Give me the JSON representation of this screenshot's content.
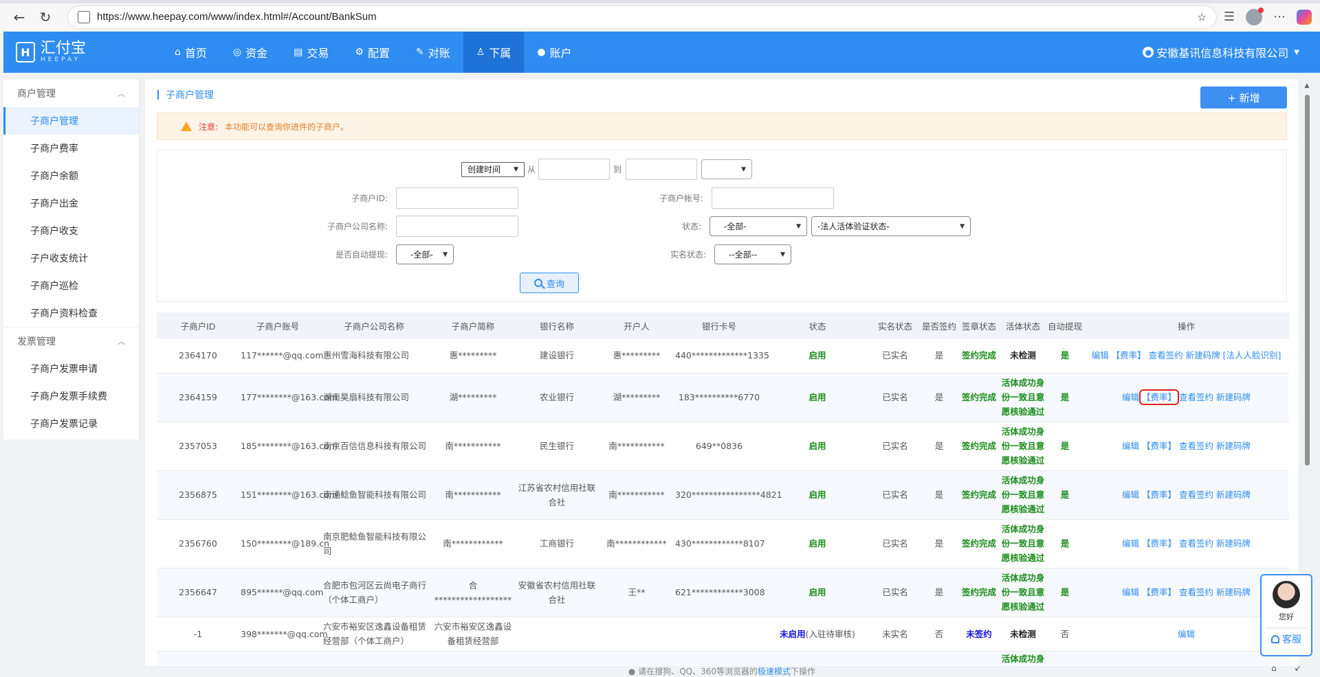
{
  "browser": {
    "url": "https://www.heepay.com/www/index.html#/Account/BankSum"
  },
  "header": {
    "logo_text": "汇付宝",
    "logo_sub": "HEEPAY",
    "nav": [
      {
        "label": "首页",
        "icon": "home-icon"
      },
      {
        "label": "资金",
        "icon": "database-icon"
      },
      {
        "label": "交易",
        "icon": "document-icon"
      },
      {
        "label": "配置",
        "icon": "gear-icon"
      },
      {
        "label": "对账",
        "icon": "edit-icon"
      },
      {
        "label": "下属",
        "icon": "person-icon"
      },
      {
        "label": "账户",
        "icon": "user-icon"
      }
    ],
    "active_nav": "下属",
    "user": "安徽基讯信息科技有限公司"
  },
  "sidebar": {
    "group1": "商户管理",
    "items1": [
      "子商户管理",
      "子商户费率",
      "子商户余额",
      "子商户出金",
      "子商户收支",
      "子户收支统计",
      "子商户巡检",
      "子商户资料检查"
    ],
    "group2": "发票管理",
    "items2": [
      "子商户发票申请",
      "子商户发票手续费",
      "子商户发票记录"
    ]
  },
  "page": {
    "title": "子商户管理",
    "add_label": "+ 新增",
    "notice_label": "注意:",
    "notice_text": "本功能可以查询你进件的子商户。"
  },
  "search": {
    "time_select": "创建时间",
    "from": "从",
    "to": "到",
    "sub_id_label": "子商户ID:",
    "sub_account_label": "子商户帐号:",
    "company_label": "子商户公司名称:",
    "status_label": "状态:",
    "status_value": "-全部-",
    "face_status_value": "-法人活体验证状态-",
    "auto_withdraw_label": "是否自动提现:",
    "auto_withdraw_value": "-全部-",
    "realname_label": "实名状态:",
    "realname_value": "--全部--",
    "query_label": "查询"
  },
  "table": {
    "headers": [
      "子商户ID",
      "子商户账号",
      "子商户公司名称",
      "子商户简称",
      "银行名称",
      "开户人",
      "银行卡号",
      "状态",
      "实名状态",
      "是否签约",
      "签章状态",
      "活体状态",
      "自动提现",
      "操作"
    ],
    "rows": [
      {
        "id": "2364170",
        "account": "117******@qq.com",
        "company": "惠州雪海科技有限公司",
        "short": "惠*********",
        "bank": "建设银行",
        "holder": "惠*********",
        "card": "440*************1335",
        "status": "启用",
        "realname": "已实名",
        "signed": "是",
        "sign_status": "签约完成",
        "face": "未检测",
        "auto": "是",
        "ops": [
          "编辑",
          "【费率】",
          "查看签约",
          "新建码牌",
          "[法人人脸识别]"
        ]
      },
      {
        "id": "2364159",
        "account": "177********@163.com",
        "company": "湖南昊扇科技有限公司",
        "short": "湖*********",
        "bank": "农业银行",
        "holder": "湖*********",
        "card": "183**********6770",
        "status": "启用",
        "realname": "已实名",
        "signed": "是",
        "sign_status": "签约完成",
        "face": "活体成功身份一致且意愿核验通过",
        "auto": "是",
        "ops": [
          "编辑",
          "【费率】",
          "查看签约",
          "新建码牌"
        ]
      },
      {
        "id": "2357053",
        "account": "185********@163.com",
        "company": "南京百信信息科技有限公司",
        "short": "南***********",
        "bank": "民生银行",
        "holder": "南***********",
        "card": "649**0836",
        "status": "启用",
        "realname": "已实名",
        "signed": "是",
        "sign_status": "签约完成",
        "face": "活体成功身份一致且意愿核验通过",
        "auto": "是",
        "ops": [
          "编辑",
          "【费率】",
          "查看签约",
          "新建码牌"
        ]
      },
      {
        "id": "2356875",
        "account": "151********@163.com",
        "company": "南通鲶鱼智能科技有限公司",
        "short": "南***********",
        "bank": "江苏省农村信用社联合社",
        "holder": "南***********",
        "card": "320****************4821",
        "status": "启用",
        "realname": "已实名",
        "signed": "是",
        "sign_status": "签约完成",
        "face": "活体成功身份一致且意愿核验通过",
        "auto": "是",
        "ops": [
          "编辑",
          "【费率】",
          "查看签约",
          "新建码牌"
        ]
      },
      {
        "id": "2356760",
        "account": "150********@189.cn",
        "company": "南京肥鲶鱼智能科技有限公司",
        "short": "南************",
        "bank": "工商银行",
        "holder": "南************",
        "card": "430************8107",
        "status": "启用",
        "realname": "已实名",
        "signed": "是",
        "sign_status": "签约完成",
        "face": "活体成功身份一致且意愿核验通过",
        "auto": "是",
        "ops": [
          "编辑",
          "【费率】",
          "查看签约",
          "新建码牌"
        ]
      },
      {
        "id": "2356647",
        "account": "895******@qq.com",
        "company": "合肥市包河区云尚电子商行（个体工商户）",
        "short": "合******************",
        "bank": "安徽省农村信用社联合社",
        "holder": "王**",
        "card": "621************3008",
        "status": "启用",
        "realname": "已实名",
        "signed": "是",
        "sign_status": "签约完成",
        "face": "活体成功身份一致且意愿核验通过",
        "auto": "是",
        "ops": [
          "编辑",
          "【费率】",
          "查看签约",
          "新建码牌"
        ]
      },
      {
        "id": "-1",
        "account": "398*******@qq.com",
        "company": "六安市裕安区逸鑫设备租赁经营部（个体工商户）",
        "short": "六安市裕安区逸鑫设备租赁经营部",
        "bank": "",
        "holder": "",
        "card": "",
        "status": "未启用",
        "status_note": "(入驻待审核)",
        "realname": "未实名",
        "signed": "否",
        "sign_status": "未签约",
        "face": "未检测",
        "auto": "否",
        "ops": [
          "编辑"
        ]
      }
    ],
    "partial_face": "活体成功身"
  },
  "footer": {
    "text_before": "请在搜狗、QQ、360等浏览器的",
    "link": "极速模式",
    "text_after": "下操作"
  },
  "service": {
    "greeting": "您好",
    "label": "客服"
  }
}
